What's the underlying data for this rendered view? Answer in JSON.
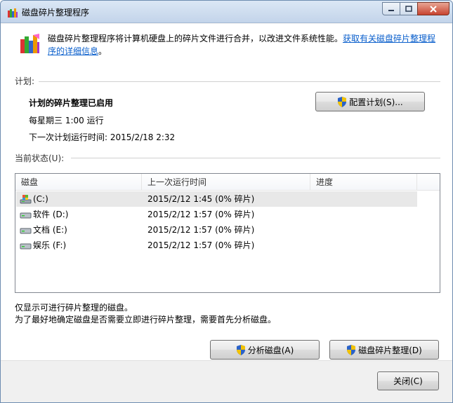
{
  "window": {
    "title": "磁盘碎片整理程序"
  },
  "intro": {
    "text": "磁盘碎片整理程序将计算机硬盘上的碎片文件进行合并，以改进文件系统性能。",
    "link": "获取有关磁盘碎片整理程序的详细信息",
    "suffix": "。"
  },
  "schedule": {
    "section_label": "计划:",
    "status": "计划的碎片整理已启用",
    "frequency": "每星期三  1:00 运行",
    "next_run": "下一次计划运行时间: 2015/2/18 2:32",
    "configure_button": "配置计划(S)..."
  },
  "current_status": {
    "section_label": "当前状态(U):",
    "columns": [
      "磁盘",
      "上一次运行时间",
      "进度"
    ],
    "rows": [
      {
        "disk": "(C:)",
        "last_run": "2015/2/12 1:45 (0% 碎片)",
        "progress": "",
        "icon": "system-drive-icon"
      },
      {
        "disk": "软件 (D:)",
        "last_run": "2015/2/12 1:57 (0% 碎片)",
        "progress": "",
        "icon": "drive-icon"
      },
      {
        "disk": "文档 (E:)",
        "last_run": "2015/2/12 1:57 (0% 碎片)",
        "progress": "",
        "icon": "drive-icon"
      },
      {
        "disk": "娱乐 (F:)",
        "last_run": "2015/2/12 1:57 (0% 碎片)",
        "progress": "",
        "icon": "drive-icon"
      }
    ]
  },
  "notes": {
    "line1": "仅显示可进行碎片整理的磁盘。",
    "line2": "为了最好地确定磁盘是否需要立即进行碎片整理，需要首先分析磁盘。"
  },
  "buttons": {
    "analyze": "分析磁盘(A)",
    "defragment": "磁盘碎片整理(D)",
    "close": "关闭(C)"
  },
  "colors": {
    "link": "#0a5fcc",
    "selected_row": "#e8e8e8"
  }
}
